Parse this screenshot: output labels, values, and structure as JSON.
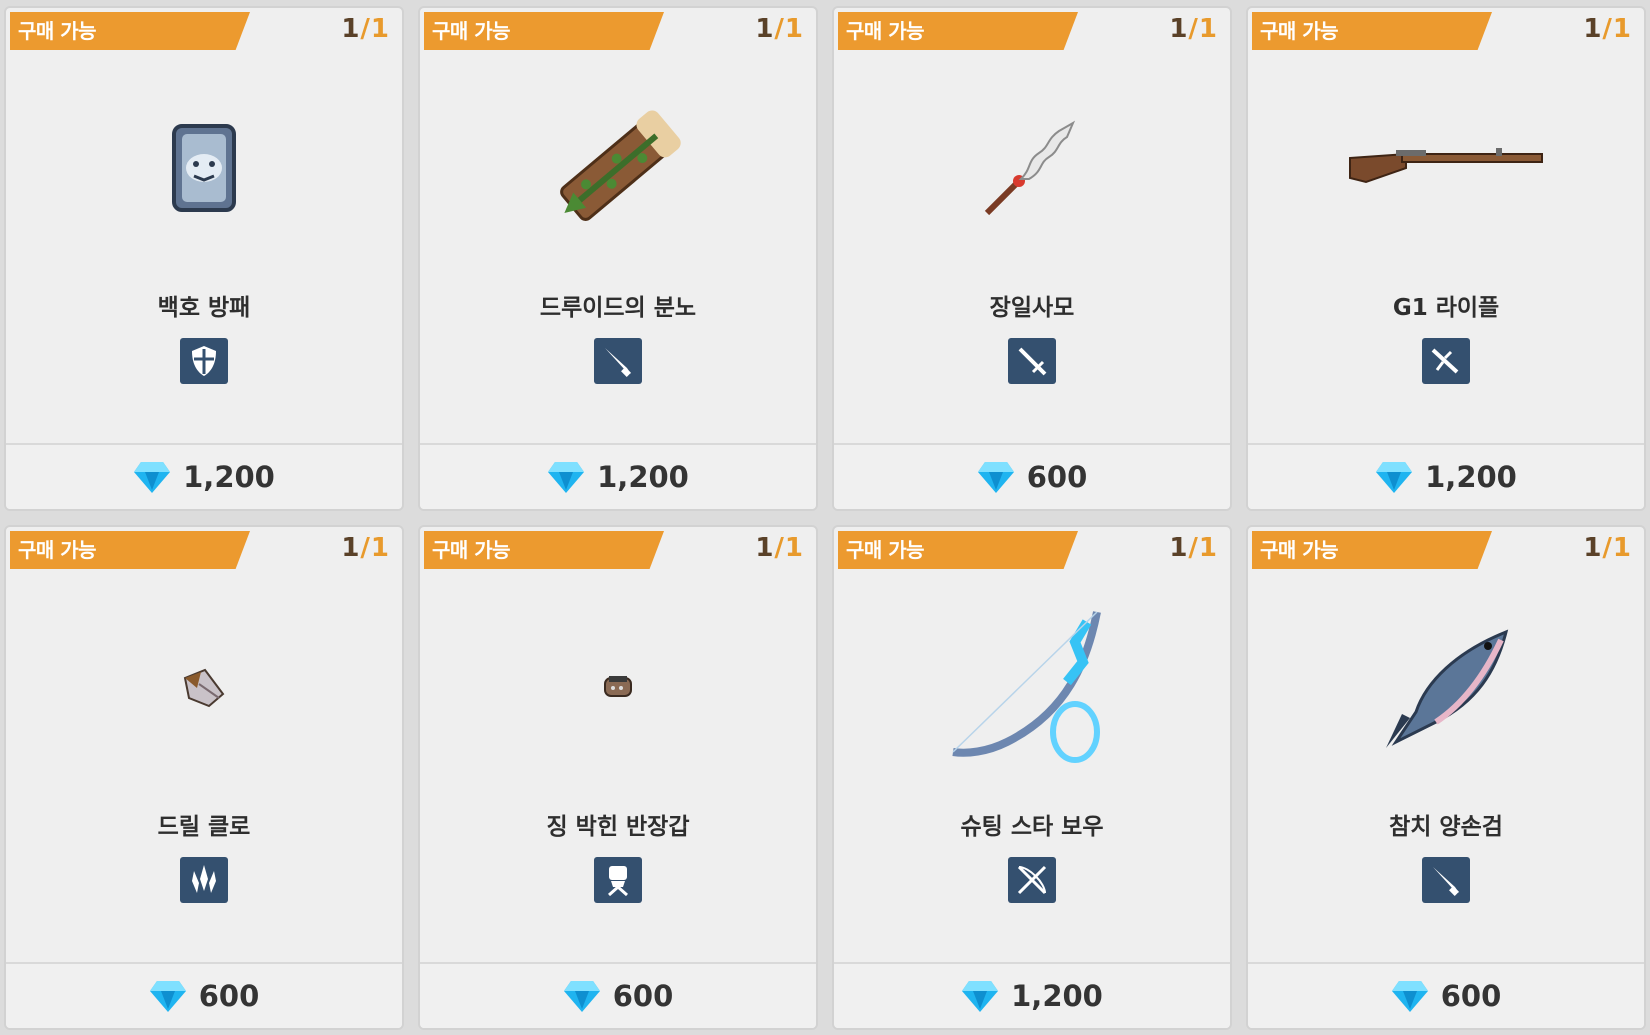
{
  "colors": {
    "badge": "#ec9a2f",
    "card_bg": "#efefef",
    "type_icon_bg": "#34506f",
    "gem": "#1fb4f0",
    "stock_text": "#5a4128"
  },
  "items": [
    {
      "badge": "구매 가능",
      "stock": "1",
      "stock_max": "1",
      "name": "백호 방패",
      "type_icon": "shield-icon",
      "price": "1,200",
      "currency_icon": "diamond-icon"
    },
    {
      "badge": "구매 가능",
      "stock": "1",
      "stock_max": "1",
      "name": "드루이드의 분노",
      "type_icon": "greatsword-icon",
      "price": "1,200",
      "currency_icon": "diamond-icon"
    },
    {
      "badge": "구매 가능",
      "stock": "1",
      "stock_max": "1",
      "name": "장일사모",
      "type_icon": "sword-icon",
      "price": "600",
      "currency_icon": "diamond-icon"
    },
    {
      "badge": "구매 가능",
      "stock": "1",
      "stock_max": "1",
      "name": "G1 라이플",
      "type_icon": "rifle-icon",
      "price": "1,200",
      "currency_icon": "diamond-icon"
    },
    {
      "badge": "구매 가능",
      "stock": "1",
      "stock_max": "1",
      "name": "드릴 클로",
      "type_icon": "claw-icon",
      "price": "600",
      "currency_icon": "diamond-icon"
    },
    {
      "badge": "구매 가능",
      "stock": "1",
      "stock_max": "1",
      "name": "징 박힌 반장갑",
      "type_icon": "gauntlet-icon",
      "price": "600",
      "currency_icon": "diamond-icon"
    },
    {
      "badge": "구매 가능",
      "stock": "1",
      "stock_max": "1",
      "name": "슈팅 스타 보우",
      "type_icon": "bow-icon",
      "price": "1,200",
      "currency_icon": "diamond-icon"
    },
    {
      "badge": "구매 가능",
      "stock": "1",
      "stock_max": "1",
      "name": "참치 양손검",
      "type_icon": "greatsword-icon",
      "price": "600",
      "currency_icon": "diamond-icon"
    }
  ]
}
